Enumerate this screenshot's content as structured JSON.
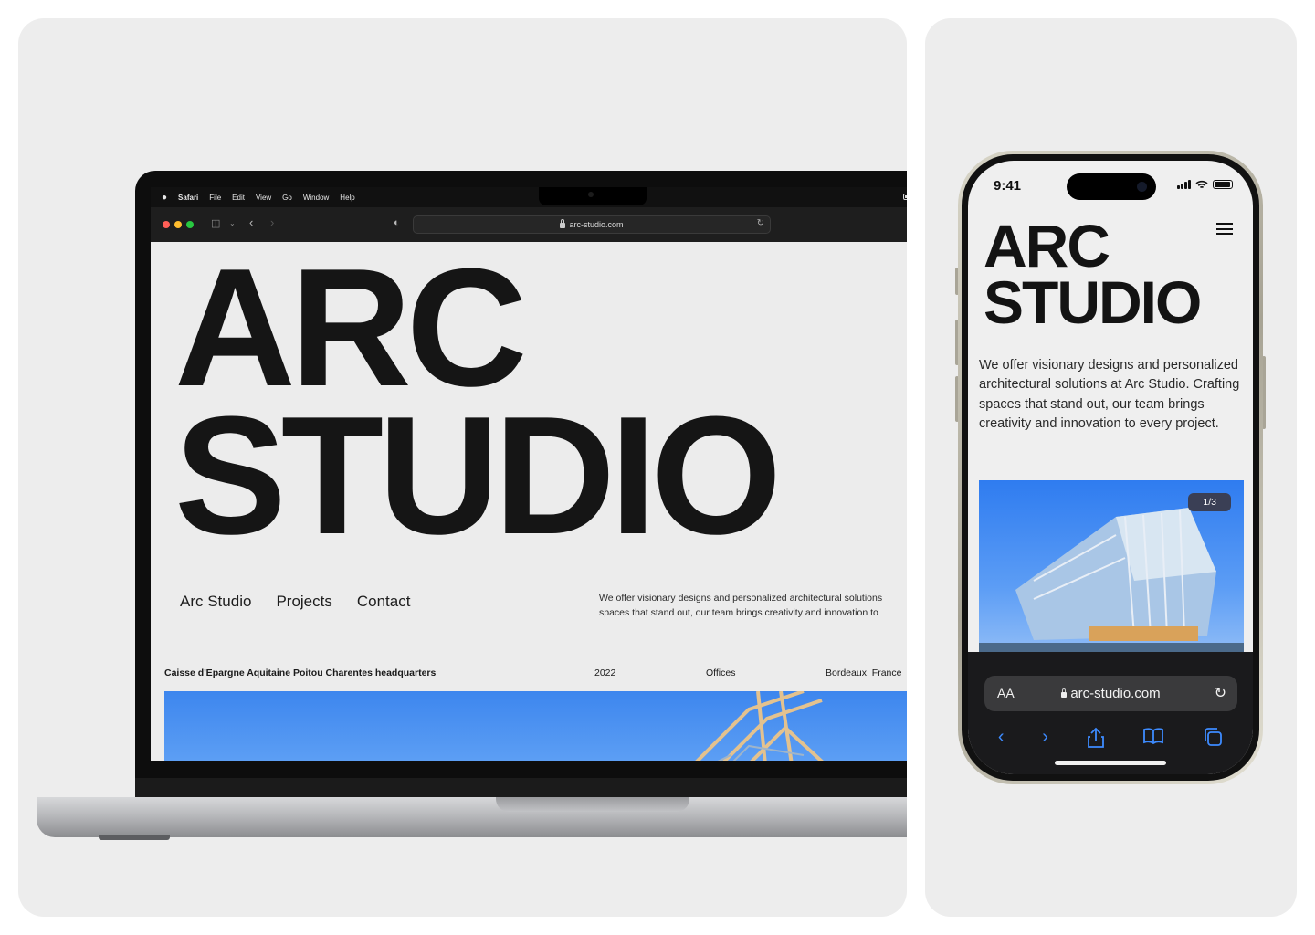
{
  "mac": {
    "menubar": {
      "apple_icon": "",
      "items": [
        "Safari",
        "File",
        "Edit",
        "View",
        "Go",
        "Window",
        "Help"
      ]
    },
    "url": "arc-studio.com",
    "hero": {
      "line1": "ARC",
      "line2": "STUDIO"
    },
    "nav": [
      "Arc Studio",
      "Projects",
      "Contact"
    ],
    "tagline": {
      "line1": "We offer visionary designs and personalized architectural solutions",
      "line2": "spaces that stand out, our team brings creativity and innovation to"
    },
    "project": {
      "name": "Caisse d'Epargne Aquitaine Poitou Charentes headquarters",
      "year": "2022",
      "type": "Offices",
      "location": "Bordeaux, France"
    }
  },
  "phone": {
    "time": "9:41",
    "hero": {
      "line1": "ARC",
      "line2": "STUDIO"
    },
    "tagline": "We offer visionary designs and personalized architectural solutions at Arc Studio. Crafting spaces that stand out, our team brings creativity and innovation to every project.",
    "pager": "1/3",
    "url": "arc-studio.com",
    "aa_label": "AA",
    "nav_icons": [
      "back-icon",
      "forward-icon",
      "share-icon",
      "bookmarks-icon",
      "tabs-icon"
    ]
  },
  "colors": {
    "panel_bg": "#ededed",
    "sky_blue": "#3d86ee",
    "ios_blue": "#3d8bff",
    "traffic_red": "#ff5f57",
    "traffic_yellow": "#febc2e",
    "traffic_green": "#28c840"
  }
}
